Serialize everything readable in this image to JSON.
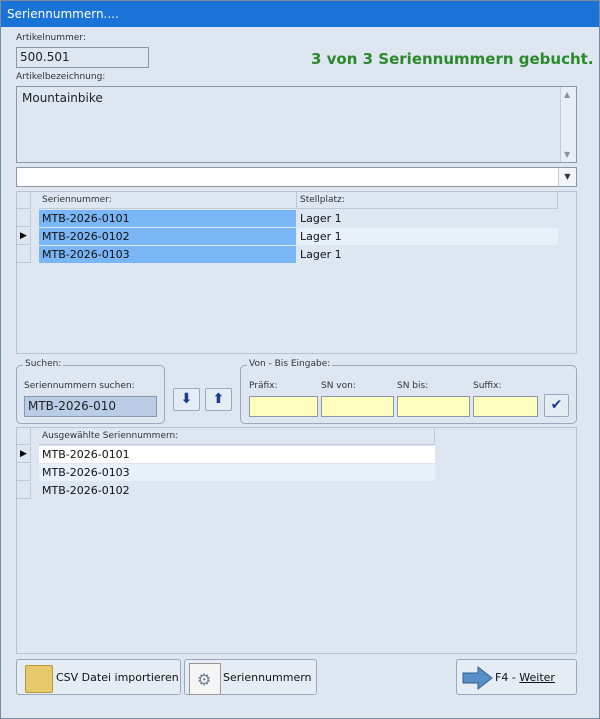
{
  "window": {
    "title": "Seriennummern...."
  },
  "status_text": "3 von 3 Seriennummern gebucht.",
  "artikel": {
    "nummer_label": "Artikelnummer:",
    "nummer_value": "500.501",
    "bezeichnung_label": "Artikelbezeichnung:",
    "bezeichnung_value": "Mountainbike"
  },
  "combo": {
    "value": ""
  },
  "serials_grid": {
    "columns": [
      "Seriennummer:",
      "Stellplatz:"
    ],
    "rows": [
      {
        "serial": "MTB-2026-0101",
        "stellplatz": "Lager 1"
      },
      {
        "serial": "MTB-2026-0102",
        "stellplatz": "Lager 1"
      },
      {
        "serial": "MTB-2026-0103",
        "stellplatz": "Lager 1"
      }
    ]
  },
  "suchen": {
    "group_title": "Suchen:",
    "label": "Seriennummern suchen:",
    "value": "MTB-2026-010"
  },
  "range": {
    "group_title": "Von - Bis Eingabe:",
    "prefix_label": "Präfix:",
    "sn_von_label": "SN von:",
    "sn_bis_label": "SN bis:",
    "suffix_label": "Suffix:"
  },
  "selected_grid": {
    "column": "Ausgewählte Seriennummern:",
    "rows": [
      "MTB-2026-0101",
      "MTB-2026-0103",
      "MTB-2026-0102"
    ]
  },
  "buttons": {
    "csv_import": "CSV Datei importieren",
    "seriennummern": "Seriennummern",
    "weiter_prefix": "F4 - ",
    "weiter_label": "Weiter"
  },
  "icons": {
    "down": "arrow-down-icon",
    "up": "arrow-up-icon",
    "check": "checkmark-icon",
    "folder": "folder-icon",
    "gear": "gear-document-icon",
    "next": "arrow-right-icon"
  },
  "colors": {
    "titlebar": "#1a73d6",
    "status": "#2a8a2a",
    "selection": "#7ab6f5",
    "input_yellow": "#ffffc0"
  }
}
